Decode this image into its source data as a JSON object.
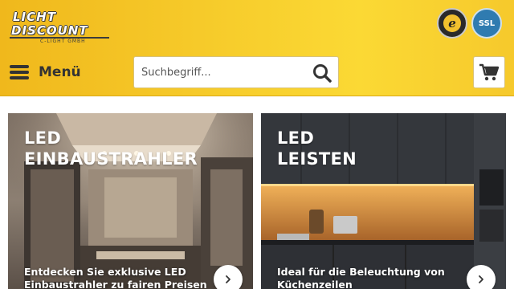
{
  "brand": {
    "line1": "LICHT",
    "line2": "DISCOUNT",
    "sub": "C-LIGHT GMBH"
  },
  "badges": {
    "trusted_letter": "e",
    "ssl": "SSL"
  },
  "menu": {
    "label": "Menü"
  },
  "search": {
    "placeholder": "Suchbegriff..."
  },
  "tiles": [
    {
      "title_line1": "LED",
      "title_line2": "EINBAUSTRAHLER",
      "text_line1": "Entdecken Sie exklusive LED",
      "text_line2": "Einbaustrahler zu fairen Preisen"
    },
    {
      "title_line1": "LED",
      "title_line2": "LEISTEN",
      "text_line1": "Ideal für die Beleuchtung von",
      "text_line2": "Küchenzeilen"
    }
  ],
  "colors": {
    "header": "#f7cd2c",
    "text_dark": "#333333"
  },
  "icons": [
    "hamburger-icon",
    "search-icon",
    "cart-icon",
    "chevron-right-icon"
  ]
}
